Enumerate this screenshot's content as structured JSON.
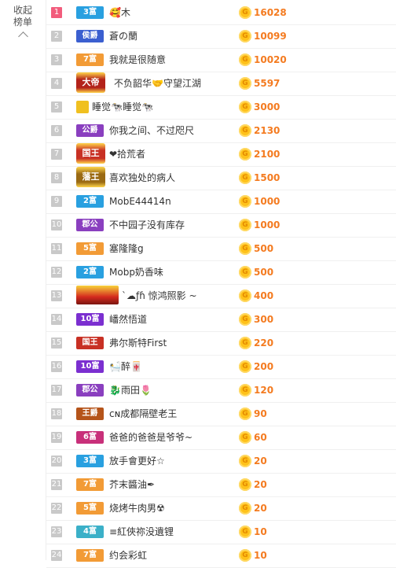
{
  "sidebar": {
    "collapse_label_1": "收起",
    "collapse_label_2": "榜单"
  },
  "rows": [
    {
      "rank": "1",
      "badge": "3富",
      "badge_color": "#29a0e0",
      "name": "🥰木",
      "score": "16028"
    },
    {
      "rank": "2",
      "badge": "侯爵",
      "badge_color": "#3b5fd0",
      "name": "蒼の蘭",
      "score": "10099"
    },
    {
      "rank": "3",
      "badge": "7富",
      "badge_color": "#f29b36",
      "name": "我就是很随意",
      "score": "10020"
    },
    {
      "rank": "4",
      "badge": "大帝",
      "badge_color": "#b3221a",
      "name": "不负韶华🤝守望江湖",
      "score": "5597"
    },
    {
      "rank": "5",
      "badge": "",
      "badge_color": "#f0c020",
      "name": "睡觉🐄睡觉🐄",
      "score": "3000"
    },
    {
      "rank": "6",
      "badge": "公爵",
      "badge_color": "#8a3fbf",
      "name": "你我之间、不过咫尺",
      "score": "2130"
    },
    {
      "rank": "7",
      "badge": "国王",
      "badge_color": "#c83024",
      "name": "❤拾荒者",
      "score": "2100"
    },
    {
      "rank": "8",
      "badge": "藩王",
      "badge_color": "#9a6a14",
      "name": "喜欢独处的病人",
      "score": "1500"
    },
    {
      "rank": "9",
      "badge": "2富",
      "badge_color": "#29a0e0",
      "name": "MobE44414n",
      "score": "1000"
    },
    {
      "rank": "10",
      "badge": "郡公",
      "badge_color": "#8a3fbf",
      "name": "不中园子没有库存",
      "score": "1000"
    },
    {
      "rank": "11",
      "badge": "5富",
      "badge_color": "#f29b36",
      "name": "塞隆隆g",
      "score": "500"
    },
    {
      "rank": "12",
      "badge": "2富",
      "badge_color": "#29a0e0",
      "name": "Mobp奶香味",
      "score": "500"
    },
    {
      "rank": "13",
      "badge": "",
      "badge_color": "#d42a1e",
      "name": "ˋ☁ƒɦ 惊鸿照影 ~",
      "score": "400"
    },
    {
      "rank": "14",
      "badge": "10富",
      "badge_color": "#7b2fd0",
      "name": "嶓然悟道",
      "score": "300"
    },
    {
      "rank": "15",
      "badge": "国王",
      "badge_color": "#c83024",
      "name": "弗尔斯特First",
      "score": "220"
    },
    {
      "rank": "16",
      "badge": "10富",
      "badge_color": "#7b2fd0",
      "name": "🛀醉🀄",
      "score": "200"
    },
    {
      "rank": "17",
      "badge": "郡公",
      "badge_color": "#8a3fbf",
      "name": "🐉雨田🌷",
      "score": "120"
    },
    {
      "rank": "18",
      "badge": "王爵",
      "badge_color": "#b5541a",
      "name": "ᴄɴ成都隔壁老王",
      "score": "90"
    },
    {
      "rank": "19",
      "badge": "6富",
      "badge_color": "#c8307a",
      "name": "爸爸的爸爸是爷爷~",
      "score": "60"
    },
    {
      "rank": "20",
      "badge": "3富",
      "badge_color": "#29a0e0",
      "name": "放手會更好☆",
      "score": "20"
    },
    {
      "rank": "21",
      "badge": "7富",
      "badge_color": "#f29b36",
      "name": "芥末醬油✒",
      "score": "20"
    },
    {
      "rank": "22",
      "badge": "5富",
      "badge_color": "#f29b36",
      "name": "烧烤牛肉男☢",
      "score": "20"
    },
    {
      "rank": "23",
      "badge": "4富",
      "badge_color": "#3bb0c8",
      "name": "≡紅俠祢没遺锂",
      "score": "10"
    },
    {
      "rank": "24",
      "badge": "7富",
      "badge_color": "#f29b36",
      "name": "约会彩虹",
      "score": "10"
    }
  ],
  "coin_glyph": "G"
}
